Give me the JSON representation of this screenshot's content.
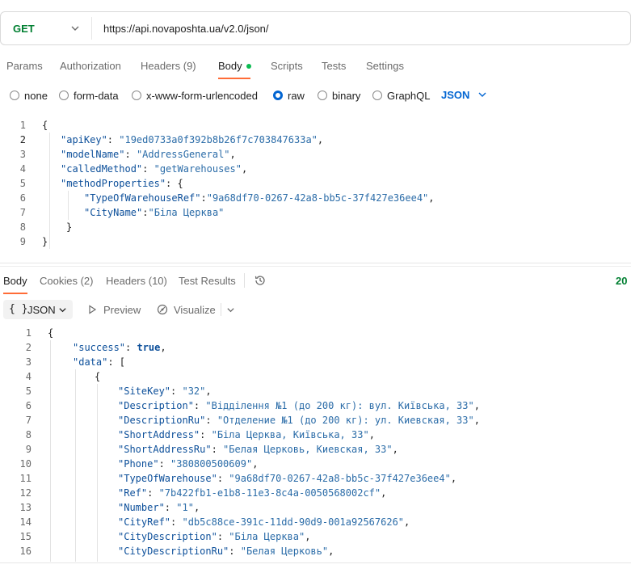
{
  "request": {
    "method": "GET",
    "url": "https://api.novaposhta.ua/v2.0/json/"
  },
  "tabs": [
    {
      "label": "Params"
    },
    {
      "label": "Authorization"
    },
    {
      "label": "Headers (9)"
    },
    {
      "label": "Body"
    },
    {
      "label": "Scripts"
    },
    {
      "label": "Tests"
    },
    {
      "label": "Settings"
    }
  ],
  "body_options": {
    "none": "none",
    "form_data": "form-data",
    "urlencoded": "x-www-form-urlencoded",
    "raw": "raw",
    "binary": "binary",
    "graphql": "GraphQL",
    "format": "JSON",
    "selected": "raw"
  },
  "request_body": {
    "line_numbers": [
      "1",
      "2",
      "3",
      "4",
      "5",
      "6",
      "7",
      "8",
      "9"
    ],
    "apiKey_key": "\"apiKey\"",
    "apiKey_val": "\"19ed0733a0f392b8b26f7c703847633a\"",
    "modelName_key": "\"modelName\"",
    "modelName_val": "\"AddressGeneral\"",
    "calledMethod_key": "\"calledMethod\"",
    "calledMethod_val": "\"getWarehouses\"",
    "methodProperties_key": "\"methodProperties\"",
    "typeRef_key": "\"TypeOfWarehouseRef\"",
    "typeRef_val": "\"9a68df70-0267-42a8-bb5c-37f427e36ee4\"",
    "cityName_key": "\"CityName\"",
    "cityName_val": "\"Біла Церква\""
  },
  "response_tabs": [
    {
      "label": "Body"
    },
    {
      "label": "Cookies (2)"
    },
    {
      "label": "Headers (10)"
    },
    {
      "label": "Test Results"
    }
  ],
  "response_status": "20",
  "response_toolbar": {
    "format_icon": "{ }",
    "format": "JSON",
    "preview": "Preview",
    "visualize": "Visualize"
  },
  "response_body": {
    "line_numbers": [
      "1",
      "2",
      "3",
      "4",
      "5",
      "6",
      "7",
      "8",
      "9",
      "10",
      "11",
      "12",
      "13",
      "14",
      "15",
      "16"
    ],
    "success_key": "\"success\"",
    "success_val": "true",
    "data_key": "\"data\"",
    "fields": [
      {
        "key": "\"SiteKey\"",
        "sep": ": ",
        "value": "\"32\""
      },
      {
        "key": "\"Description\"",
        "sep": ": ",
        "value": "\"Відділення №1 (до 200 кг): вул. Київська, 33\""
      },
      {
        "key": "\"DescriptionRu\"",
        "sep": ": ",
        "value": "\"Отделение №1 (до 200 кг): ул. Киевская, 33\""
      },
      {
        "key": "\"ShortAddress\"",
        "sep": ": ",
        "value": "\"Біла Церква, Київська, 33\""
      },
      {
        "key": "\"ShortAddressRu\"",
        "sep": ": ",
        "value": "\"Белая Церковь, Киевская, 33\""
      },
      {
        "key": "\"Phone\"",
        "sep": ": ",
        "value": "\"380800500609\""
      },
      {
        "key": "\"TypeOfWarehouse\"",
        "sep": ": ",
        "value": "\"9a68df70-0267-42a8-bb5c-37f427e36ee4\""
      },
      {
        "key": "\"Ref\"",
        "sep": ": ",
        "value": "\"7b422fb1-e1b8-11e3-8c4a-0050568002cf\""
      },
      {
        "key": "\"Number\"",
        "sep": ": ",
        "value": "\"1\""
      },
      {
        "key": "\"CityRef\"",
        "sep": ": ",
        "value": "\"db5c88ce-391c-11dd-90d9-001a92567626\""
      },
      {
        "key": "\"CityDescription\"",
        "sep": ": ",
        "value": "\"Біла Церква\""
      },
      {
        "key": "\"CityDescriptionRu\"",
        "sep": ": ",
        "value": "\"Белая Церковь\""
      }
    ]
  }
}
